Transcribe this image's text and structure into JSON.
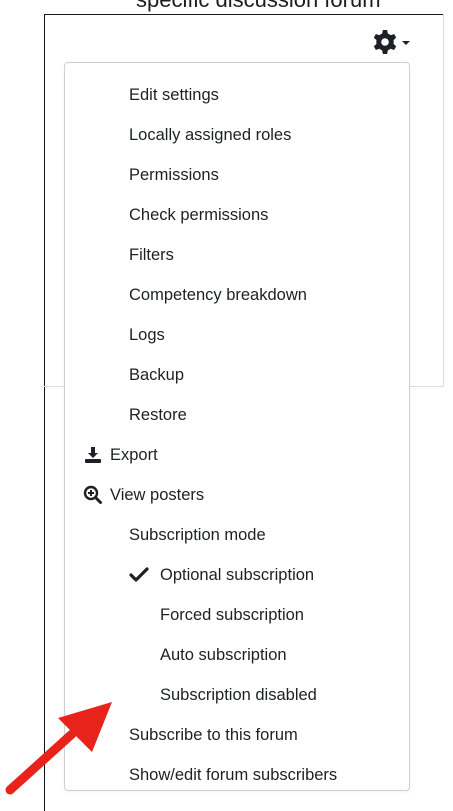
{
  "caption": {
    "text": "specific discussion forum"
  },
  "gear": {
    "icon": "gear-icon",
    "caret_icon": "caret-down-icon"
  },
  "menu": {
    "items": [
      {
        "label": "Edit settings"
      },
      {
        "label": "Locally assigned roles"
      },
      {
        "label": "Permissions"
      },
      {
        "label": "Check permissions"
      },
      {
        "label": "Filters"
      },
      {
        "label": "Competency breakdown"
      },
      {
        "label": "Logs"
      },
      {
        "label": "Backup"
      },
      {
        "label": "Restore"
      },
      {
        "label": "Export",
        "icon": "download-icon"
      },
      {
        "label": "View posters",
        "icon": "zoom-in-icon"
      },
      {
        "label": "Subscription mode"
      },
      {
        "label": "Optional subscription",
        "icon": "checkmark-icon",
        "selected": true
      },
      {
        "label": "Forced subscription"
      },
      {
        "label": "Auto subscription"
      },
      {
        "label": "Subscription disabled"
      },
      {
        "label": "Subscribe to this forum"
      },
      {
        "label": "Show/edit forum subscribers"
      }
    ]
  },
  "annotation": {
    "arrow_color": "#e8231c",
    "arrow_icon": "red-arrow-icon"
  },
  "colors": {
    "text": "#1d2125",
    "menu_border": "#cfcfcf",
    "arrow": "#e8231c"
  }
}
